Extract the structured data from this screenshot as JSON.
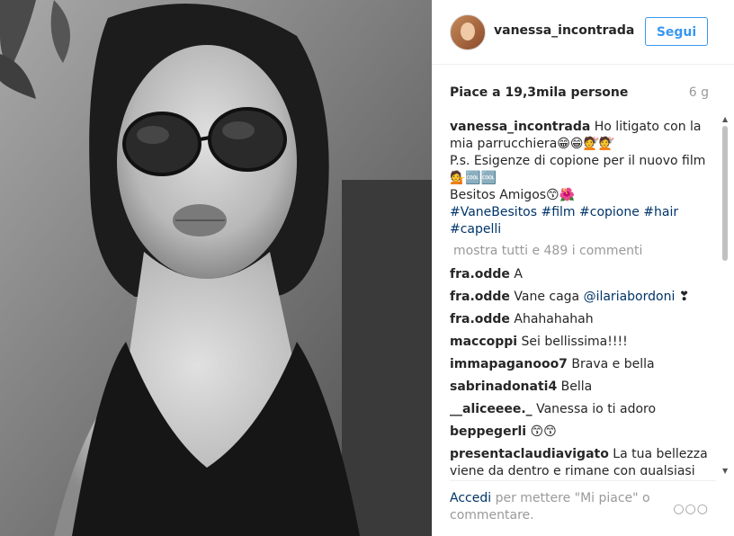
{
  "post": {
    "username": "vanessa_incontrada",
    "follow_label": "Segui",
    "likes": "Piace a 19,3mila persone",
    "age": "6 g"
  },
  "caption": {
    "username": "vanessa_incontrada",
    "line1": "Ho litigato con la mia parrucchiera😁😁💇💇",
    "line2": "P.s. Esigenze di copione per il nuovo film💁🆒🆒",
    "line3": "Besitos Amigos😙🌺",
    "hashtags": "#VaneBesitos #film #copione #hair #capelli"
  },
  "show_all_comments": "mostra tutti e 489 i commenti",
  "comments": [
    {
      "user": "fra.odde",
      "text": "A"
    },
    {
      "user": "fra.odde",
      "text": "Vane caga ",
      "mention": "@ilariabordoni",
      "suffix": " ❣"
    },
    {
      "user": "fra.odde",
      "text": "Ahahahahah"
    },
    {
      "user": "maccoppi",
      "text": "Sei bellissima!!!!"
    },
    {
      "user": "immapaganooo7",
      "text": "Brava e bella"
    },
    {
      "user": "sabrinadonati4",
      "text": "Bella"
    },
    {
      "user": "__aliceeee._",
      "text": "Vanessa io ti adoro"
    },
    {
      "user": "beppegerli",
      "text": "😙😙"
    },
    {
      "user": "presentaclaudiavigato",
      "text": "La tua bellezza viene da dentro e rimane con qualsiasi"
    }
  ],
  "footer": {
    "login_label": "Accedi",
    "rest": "per mettere \"Mi piace\" o commentare.",
    "more_icon": "more-dots-icon"
  },
  "colors": {
    "follow_blue": "#3897f0",
    "link_navy": "#003569",
    "muted_gray": "#999999"
  }
}
